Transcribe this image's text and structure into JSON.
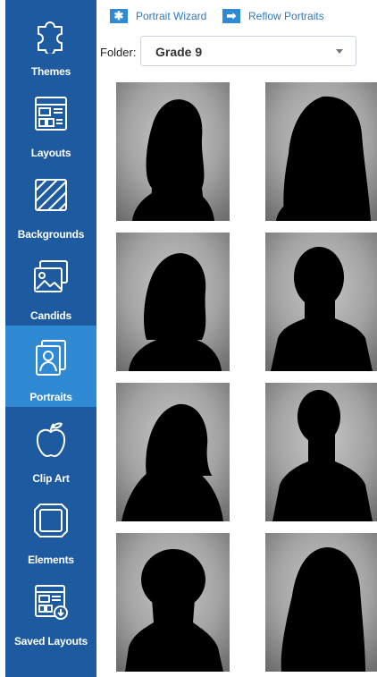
{
  "sidebar": {
    "items": [
      {
        "label": "Themes",
        "icon": "puzzle-icon"
      },
      {
        "label": "Layouts",
        "icon": "layout-icon"
      },
      {
        "label": "Backgrounds",
        "icon": "backgrounds-icon"
      },
      {
        "label": "Candids",
        "icon": "photos-icon"
      },
      {
        "label": "Portraits",
        "icon": "portrait-icon",
        "active": true
      },
      {
        "label": "Clip Art",
        "icon": "apple-icon"
      },
      {
        "label": "Elements",
        "icon": "frame-icon"
      },
      {
        "label": "Saved Layouts",
        "icon": "saved-layout-icon"
      }
    ]
  },
  "toolbar": {
    "portrait_wizard_label": "Portrait Wizard",
    "reflow_portraits_label": "Reflow Portraits"
  },
  "folder": {
    "label": "Folder:",
    "selected": "Grade 9"
  },
  "portraits": {
    "count": 8
  },
  "colors": {
    "sidebar": "#1e5aa0",
    "sidebar_active": "#2f8ad3",
    "toolbar_icon": "#2f8ad3",
    "toolbar_text": "#2e78c2"
  }
}
